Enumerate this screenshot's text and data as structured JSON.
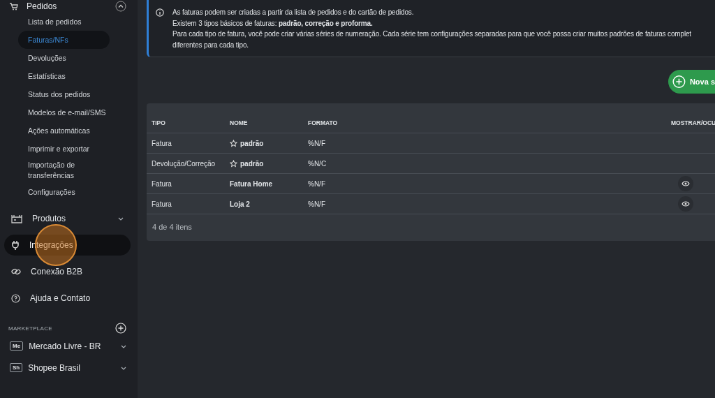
{
  "sidebar": {
    "section": {
      "label": "Pedidos",
      "expanded": true,
      "items": [
        {
          "label": "Lista de pedidos",
          "selected": false
        },
        {
          "label": "Faturas/NFs",
          "selected": true
        },
        {
          "label": "Devoluções",
          "selected": false
        },
        {
          "label": "Estatísticas",
          "selected": false
        },
        {
          "label": "Status dos pedidos",
          "selected": false
        },
        {
          "label": "Modelos de e-mail/SMS",
          "selected": false
        },
        {
          "label": "Ações automáticas",
          "selected": false
        },
        {
          "label": "Imprimir e exportar",
          "selected": false
        },
        {
          "label": "Importação de transferências",
          "selected": false
        },
        {
          "label": "Configurações",
          "selected": false
        }
      ]
    },
    "nav": [
      {
        "label": "Produtos",
        "chevron": true,
        "selected": false
      },
      {
        "label": "Integrações",
        "chevron": false,
        "selected": true
      },
      {
        "label": "Conexão B2B",
        "chevron": false,
        "selected": false
      },
      {
        "label": "Ajuda e Contato",
        "chevron": false,
        "selected": false
      }
    ],
    "marketplace": {
      "title": "MARKETPLACE",
      "items": [
        {
          "badge": "Me",
          "label": "Mercado Livre - BR"
        },
        {
          "badge": "Sh",
          "label": "Shopee Brasil"
        }
      ]
    }
  },
  "info": {
    "lines": [
      "As faturas podem ser criadas a partir da lista de pedidos e do cartão de pedidos.",
      "Existem 3 tipos básicos de faturas: **padrão, correção e proforma.**",
      "Para cada tipo de fatura, você pode criar várias séries de numeração. Cada série tem configurações separadas para que você possa criar muitos padrões de faturas complet",
      "diferentes para cada tipo."
    ]
  },
  "new_button": "Nova s",
  "table": {
    "columns": [
      "TIPO",
      "NOME",
      "FORMATO",
      "MOSTRAR/OCU"
    ],
    "rows": [
      {
        "tipo": "Fatura",
        "nome": "padrão",
        "default": true,
        "formato": "%N/F",
        "toggle": false
      },
      {
        "tipo": "Devolução/Correção",
        "nome": "padrão",
        "default": true,
        "formato": "%N/C",
        "toggle": false
      },
      {
        "tipo": "Fatura",
        "nome": "Fatura Home",
        "default": false,
        "formato": "%N/F",
        "toggle": true
      },
      {
        "tipo": "Fatura",
        "nome": "Loja 2",
        "default": false,
        "formato": "%N/F",
        "toggle": true
      }
    ],
    "footer": "4 de 4 itens"
  }
}
